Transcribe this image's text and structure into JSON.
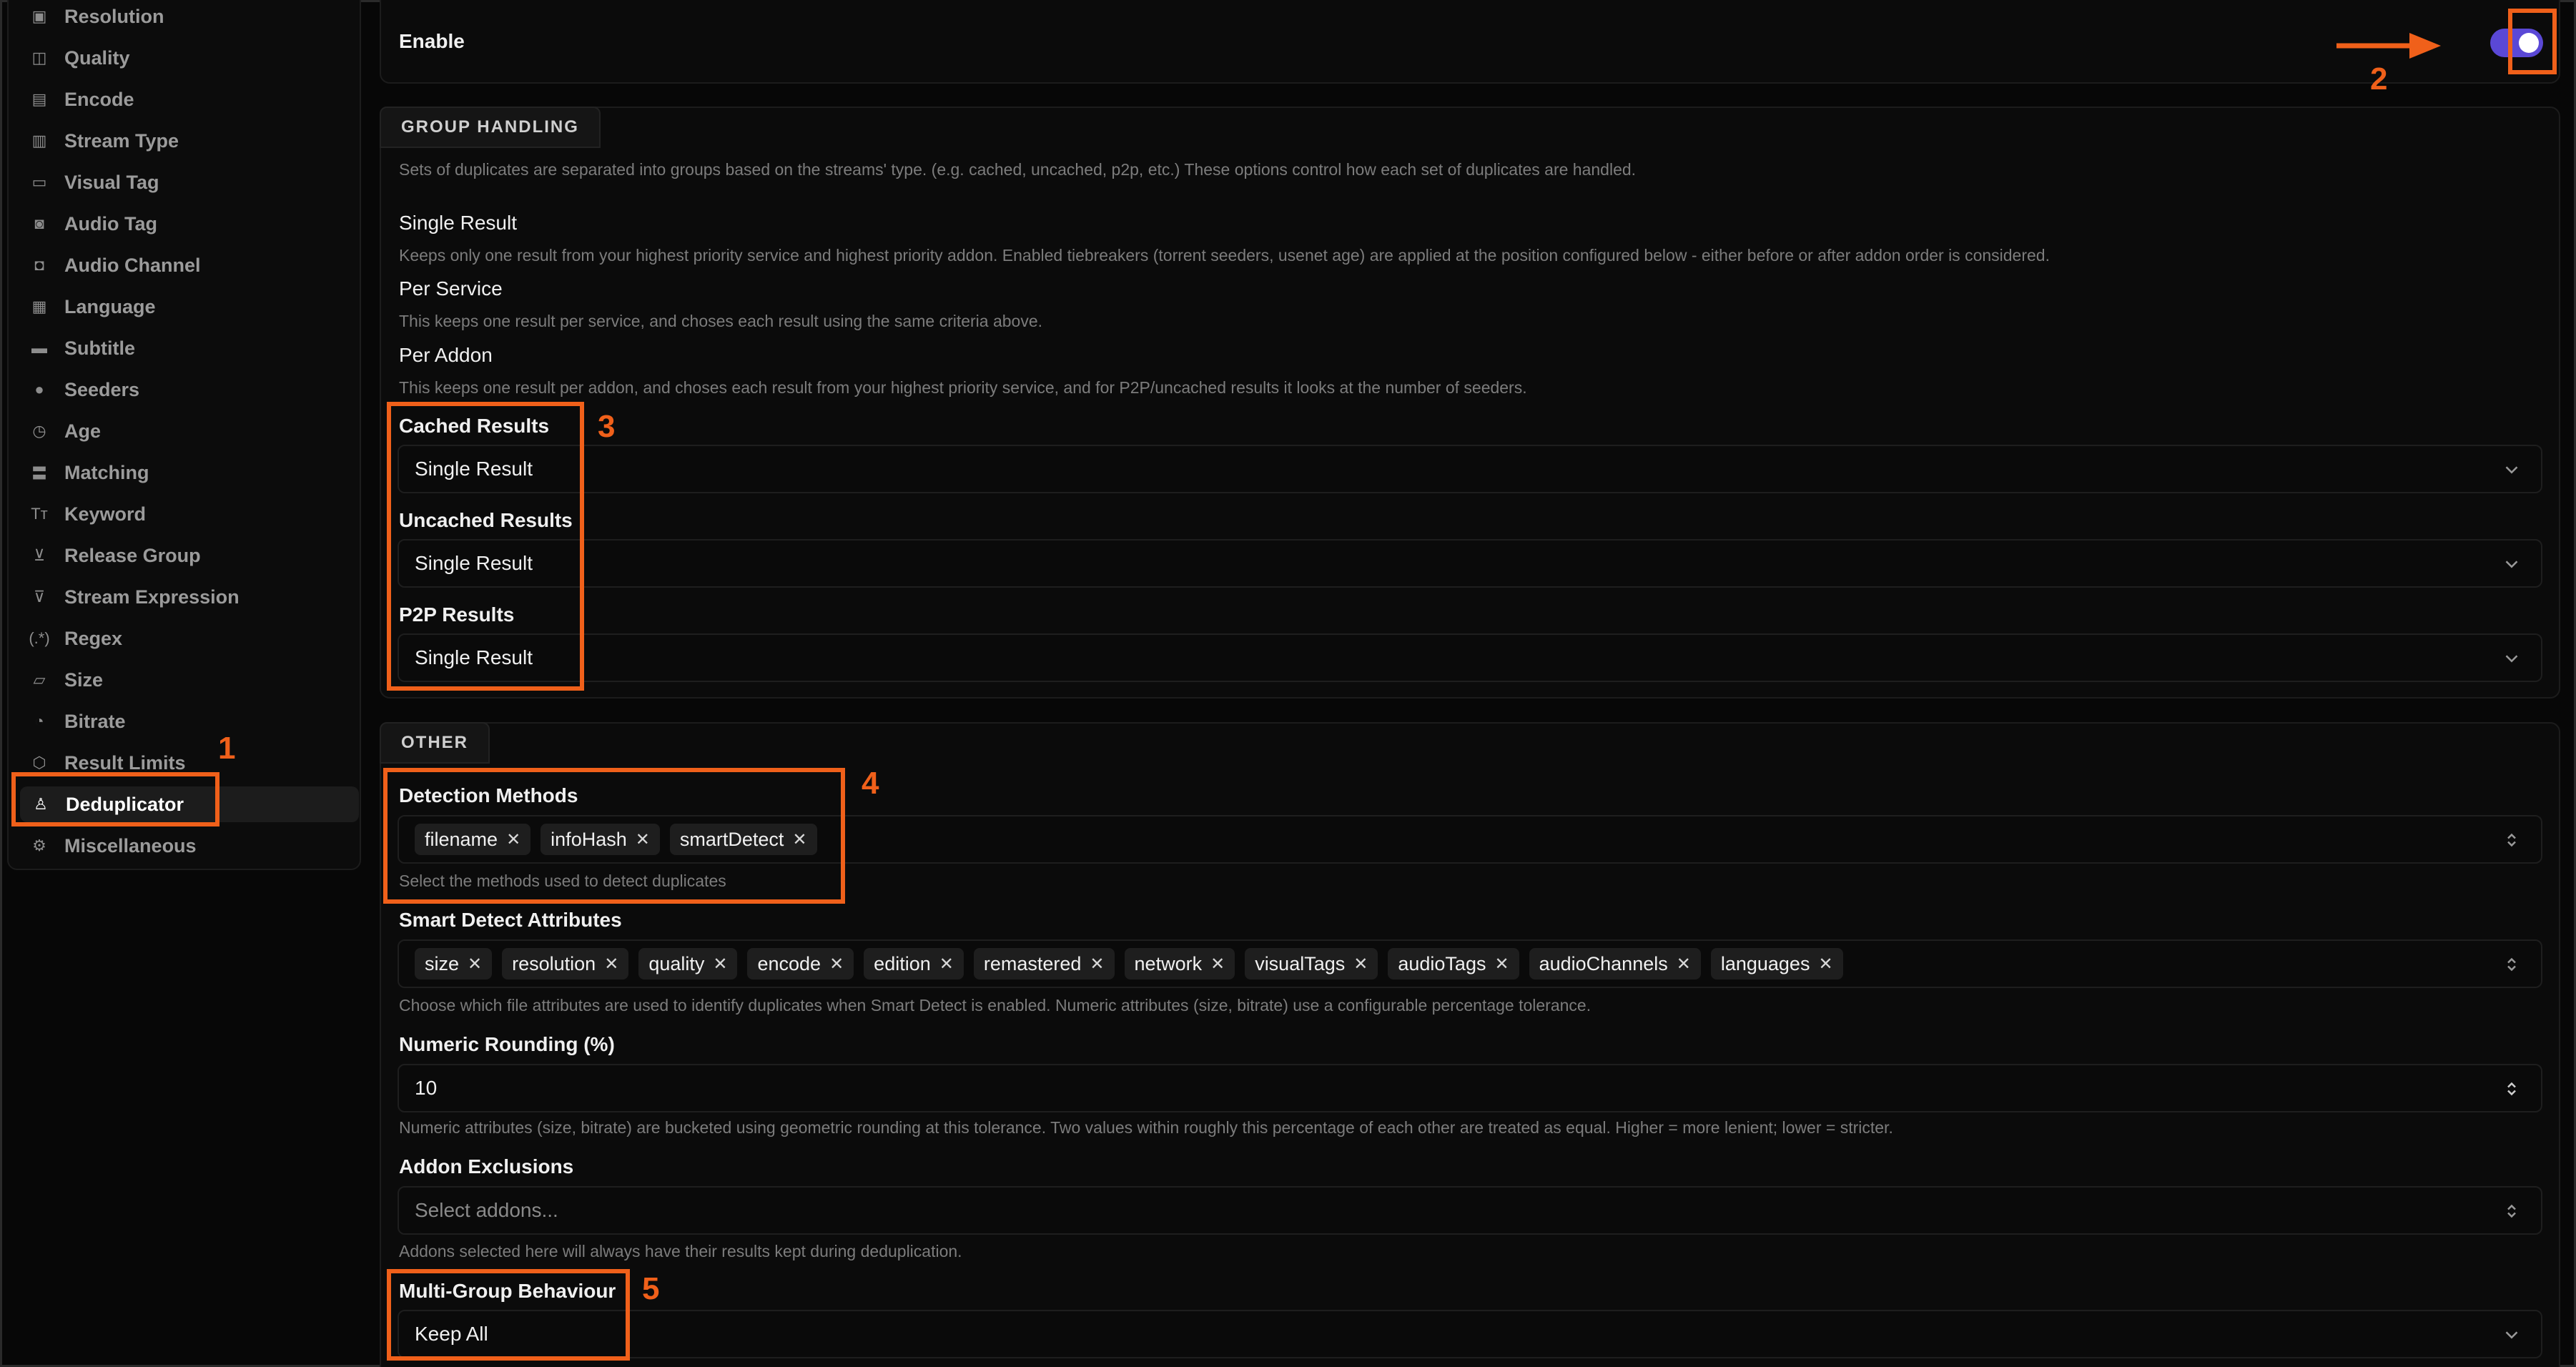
{
  "sidebar": {
    "items": [
      {
        "label": "Resolution",
        "icon": "resolution-icon",
        "glyph": "▣"
      },
      {
        "label": "Quality",
        "icon": "quality-icon",
        "glyph": "◫"
      },
      {
        "label": "Encode",
        "icon": "film-icon",
        "glyph": "▤"
      },
      {
        "label": "Stream Type",
        "icon": "stream-type-icon",
        "glyph": "▥"
      },
      {
        "label": "Visual Tag",
        "icon": "hdr-icon",
        "glyph": "▭"
      },
      {
        "label": "Audio Tag",
        "icon": "speaker-icon",
        "glyph": "◙"
      },
      {
        "label": "Audio Channel",
        "icon": "audio-channel-icon",
        "glyph": "◘"
      },
      {
        "label": "Language",
        "icon": "language-icon",
        "glyph": "▦"
      },
      {
        "label": "Subtitle",
        "icon": "subtitle-icon",
        "glyph": "▬"
      },
      {
        "label": "Seeders",
        "icon": "user-icon",
        "glyph": "●"
      },
      {
        "label": "Age",
        "icon": "clock-icon",
        "glyph": "◷"
      },
      {
        "label": "Matching",
        "icon": "equals-icon",
        "glyph": "〓"
      },
      {
        "label": "Keyword",
        "icon": "text-icon",
        "glyph": "Tт"
      },
      {
        "label": "Release Group",
        "icon": "filter-off-icon",
        "glyph": "⊻"
      },
      {
        "label": "Stream Expression",
        "icon": "funnel-icon",
        "glyph": "⊽"
      },
      {
        "label": "Regex",
        "icon": "regex-icon",
        "glyph": "(.*)"
      },
      {
        "label": "Size",
        "icon": "folder-icon",
        "glyph": "▱"
      },
      {
        "label": "Bitrate",
        "icon": "gauge-icon",
        "glyph": "◔"
      },
      {
        "label": "Result Limits",
        "icon": "box-icon",
        "glyph": "⬡"
      },
      {
        "label": "Deduplicator",
        "icon": "broom-icon",
        "glyph": "♙"
      },
      {
        "label": "Miscellaneous",
        "icon": "settings-icon",
        "glyph": "⚙"
      }
    ]
  },
  "enable": {
    "label": "Enable",
    "on": true
  },
  "group_handling": {
    "tab": "GROUP HANDLING",
    "description": "Sets of duplicates are separated into groups based on the streams' type. (e.g. cached, uncached, p2p, etc.) These options control how each set of duplicates are handled.",
    "options": [
      {
        "title": "Single Result",
        "desc": "Keeps only one result from your highest priority service and highest priority addon. Enabled tiebreakers (torrent seeders, usenet age) are applied at the position configured below - either before or after addon order is considered."
      },
      {
        "title": "Per Service",
        "desc": "This keeps one result per service, and choses each result using the same criteria above."
      },
      {
        "title": "Per Addon",
        "desc": "This keeps one result per addon, and choses each result from your highest priority service, and for P2P/uncached results it looks at the number of seeders."
      }
    ],
    "cached": {
      "label": "Cached Results",
      "value": "Single Result"
    },
    "uncached": {
      "label": "Uncached Results",
      "value": "Single Result"
    },
    "p2p": {
      "label": "P2P Results",
      "value": "Single Result"
    }
  },
  "other": {
    "tab": "OTHER",
    "detection": {
      "label": "Detection Methods",
      "chips": [
        "filename",
        "infoHash",
        "smartDetect"
      ],
      "help": "Select the methods used to detect duplicates"
    },
    "smart": {
      "label": "Smart Detect Attributes",
      "chips": [
        "size",
        "resolution",
        "quality",
        "encode",
        "edition",
        "remastered",
        "network",
        "visualTags",
        "audioTags",
        "audioChannels",
        "languages"
      ],
      "help": "Choose which file attributes are used to identify duplicates when Smart Detect is enabled. Numeric attributes (size, bitrate) use a configurable percentage tolerance."
    },
    "rounding": {
      "label": "Numeric Rounding (%)",
      "value": "10",
      "help": "Numeric attributes (size, bitrate) are bucketed using geometric rounding at this tolerance. Two values within roughly this percentage of each other are treated as equal. Higher = more lenient; lower = stricter."
    },
    "exclusions": {
      "label": "Addon Exclusions",
      "placeholder": "Select addons...",
      "help": "Addons selected here will always have their results kept during deduplication."
    },
    "multigroup": {
      "label": "Multi-Group Behaviour",
      "value": "Keep All"
    }
  },
  "annotations": {
    "color": "#f0601a",
    "n1": "1",
    "n2": "2",
    "n3": "3",
    "n4": "4",
    "n5": "5"
  }
}
